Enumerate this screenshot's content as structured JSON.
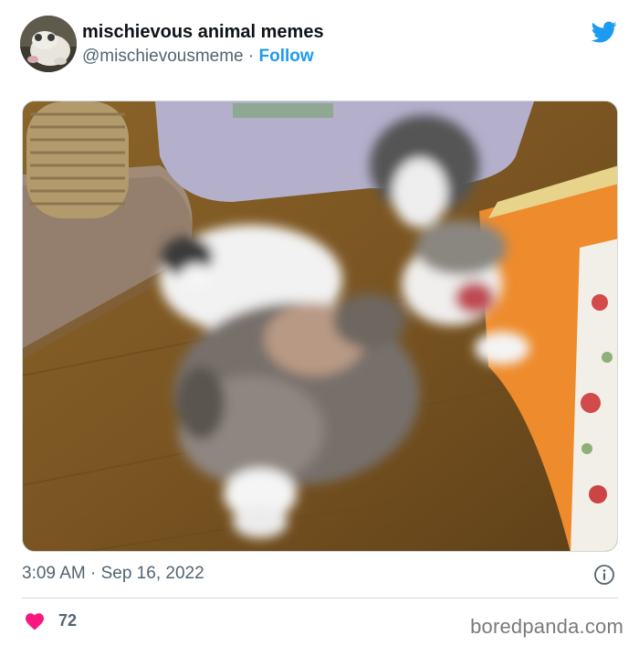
{
  "tweet": {
    "author": {
      "display_name": "mischievous animal memes",
      "handle": "@mischievousmeme",
      "separator": " · ",
      "follow_label": "Follow",
      "avatar_icon": "frog-avatar"
    },
    "platform_icon": "twitter-bird-icon",
    "media": {
      "kind": "photo"
    },
    "timestamp": "3:09 AM · Sep 16, 2022",
    "info_icon": "info-icon",
    "likes": {
      "icon": "heart-icon",
      "count": "72"
    }
  },
  "watermark": "boredpanda.com",
  "colors": {
    "accent": "#1d9bf0",
    "heart": "#f91880",
    "text_primary": "#0f1419",
    "text_secondary": "#536471",
    "divider": "#cfd9de"
  }
}
